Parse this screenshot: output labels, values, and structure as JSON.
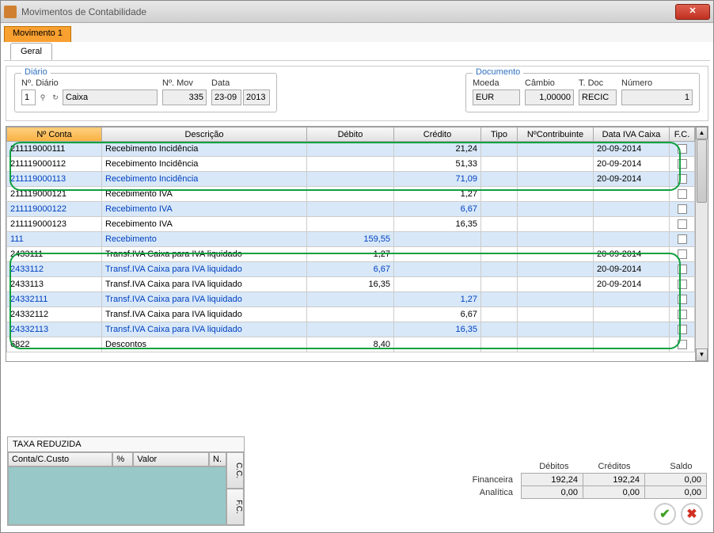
{
  "window": {
    "title": "Movimentos de Contabilidade"
  },
  "tabs": {
    "movement": "Movimento 1",
    "general": "Geral"
  },
  "diario": {
    "legend": "Diário",
    "ndiario_label": "Nº. Diário",
    "ndiario_value": "1",
    "diario_name": "Caixa",
    "nmov_label": "Nº. Mov",
    "nmov_value": "335",
    "data_label": "Data",
    "data_day": "23-09",
    "data_year": "2013"
  },
  "documento": {
    "legend": "Documento",
    "moeda_label": "Moeda",
    "moeda_value": "EUR",
    "cambio_label": "Câmbio",
    "cambio_value": "1,00000",
    "tdoc_label": "T. Doc",
    "tdoc_value": "RECIC",
    "numero_label": "Número",
    "numero_value": "1"
  },
  "grid": {
    "headers": {
      "nconta": "Nº Conta",
      "descricao": "Descrição",
      "debito": "Débito",
      "credito": "Crédito",
      "tipo": "Tipo",
      "ncontrib": "NºContribuinte",
      "dataiva": "Data IVA Caixa",
      "fc": "F.C."
    },
    "rows": [
      {
        "conta": "211119000111",
        "desc": "Recebimento Incidência",
        "deb": "",
        "cred": "21,24",
        "tipo": "",
        "ncontrib": "",
        "dataiva": "20-09-2014",
        "blue": false
      },
      {
        "conta": "211119000112",
        "desc": "Recebimento Incidência",
        "deb": "",
        "cred": "51,33",
        "tipo": "",
        "ncontrib": "",
        "dataiva": "20-09-2014",
        "blue": false
      },
      {
        "conta": "211119000113",
        "desc": "Recebimento Incidência",
        "deb": "",
        "cred": "71,09",
        "tipo": "",
        "ncontrib": "",
        "dataiva": "20-09-2014",
        "blue": true
      },
      {
        "conta": "211119000121",
        "desc": "Recebimento IVA",
        "deb": "",
        "cred": "1,27",
        "tipo": "",
        "ncontrib": "",
        "dataiva": "",
        "blue": false
      },
      {
        "conta": "211119000122",
        "desc": "Recebimento IVA",
        "deb": "",
        "cred": "6,67",
        "tipo": "",
        "ncontrib": "",
        "dataiva": "",
        "blue": true
      },
      {
        "conta": "211119000123",
        "desc": "Recebimento IVA",
        "deb": "",
        "cred": "16,35",
        "tipo": "",
        "ncontrib": "",
        "dataiva": "",
        "blue": false
      },
      {
        "conta": "111",
        "desc": "Recebimento",
        "deb": "159,55",
        "cred": "",
        "tipo": "",
        "ncontrib": "",
        "dataiva": "",
        "blue": true
      },
      {
        "conta": "2433111",
        "desc": "Transf.IVA Caixa para IVA liquidado",
        "deb": "1,27",
        "cred": "",
        "tipo": "",
        "ncontrib": "",
        "dataiva": "20-09-2014",
        "blue": false
      },
      {
        "conta": "2433112",
        "desc": "Transf.IVA Caixa para IVA liquidado",
        "deb": "6,67",
        "cred": "",
        "tipo": "",
        "ncontrib": "",
        "dataiva": "20-09-2014",
        "blue": true
      },
      {
        "conta": "2433113",
        "desc": "Transf.IVA Caixa para IVA liquidado",
        "deb": "16,35",
        "cred": "",
        "tipo": "",
        "ncontrib": "",
        "dataiva": "20-09-2014",
        "blue": false
      },
      {
        "conta": "24332111",
        "desc": "Transf.IVA Caixa para IVA liquidado",
        "deb": "",
        "cred": "1,27",
        "tipo": "",
        "ncontrib": "",
        "dataiva": "",
        "blue": true
      },
      {
        "conta": "24332112",
        "desc": "Transf.IVA Caixa para IVA liquidado",
        "deb": "",
        "cred": "6,67",
        "tipo": "",
        "ncontrib": "",
        "dataiva": "",
        "blue": false
      },
      {
        "conta": "24332113",
        "desc": "Transf.IVA Caixa para IVA liquidado",
        "deb": "",
        "cred": "16,35",
        "tipo": "",
        "ncontrib": "",
        "dataiva": "",
        "blue": true
      },
      {
        "conta": "6822",
        "desc": "Descontos",
        "deb": "8,40",
        "cred": "",
        "tipo": "",
        "ncontrib": "",
        "dataiva": "",
        "blue": false
      }
    ]
  },
  "taxa": {
    "title": "TAXA REDUZIDA",
    "cols": {
      "conta": "Conta/C.Custo",
      "pct": "%",
      "valor": "Valor",
      "n": "N."
    },
    "side": {
      "cc": "C.C.",
      "fc": "F.C."
    }
  },
  "totals": {
    "headers": {
      "debitos": "Débitos",
      "creditos": "Créditos",
      "saldo": "Saldo"
    },
    "rows": {
      "financeira_label": "Financeira",
      "financeira": {
        "deb": "192,24",
        "cred": "192,24",
        "saldo": "0,00"
      },
      "analitica_label": "Analítica",
      "analitica": {
        "deb": "0,00",
        "cred": "0,00",
        "saldo": "0,00"
      }
    }
  }
}
